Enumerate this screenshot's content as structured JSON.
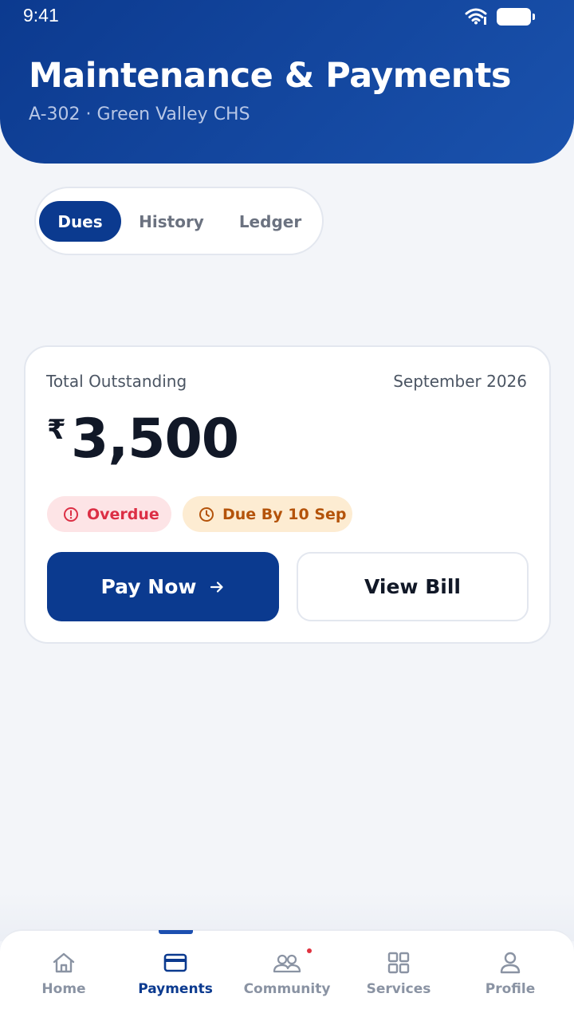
{
  "status_bar": {
    "time": "9:41"
  },
  "header": {
    "title": "Maintenance & Payments",
    "subtitle": "A-302 · Green Valley CHS"
  },
  "segments": [
    {
      "label": "Dues",
      "active": true
    },
    {
      "label": "History",
      "active": false
    },
    {
      "label": "Ledger",
      "active": false
    }
  ],
  "dues_card": {
    "label": "Total Outstanding",
    "period": "September 2026",
    "currency_symbol": "₹",
    "amount": "3,500",
    "badges": {
      "overdue": "Overdue",
      "due_date": "Due By 10 Sep"
    },
    "pay_button": "Pay Now",
    "view_button": "View Bill"
  },
  "tabbar": {
    "items": [
      {
        "label": "Home",
        "icon": "home-icon",
        "active": false
      },
      {
        "label": "Payments",
        "icon": "card-icon",
        "active": true
      },
      {
        "label": "Community",
        "icon": "people-icon",
        "active": false,
        "notification": true
      },
      {
        "label": "Services",
        "icon": "grid-icon",
        "active": false
      },
      {
        "label": "Profile",
        "icon": "user-icon",
        "active": false
      }
    ]
  },
  "colors": {
    "primary": "#0b3a8f",
    "background": "#f3f5f9",
    "overdue": "#dc2f45",
    "due": "#b4530a"
  }
}
